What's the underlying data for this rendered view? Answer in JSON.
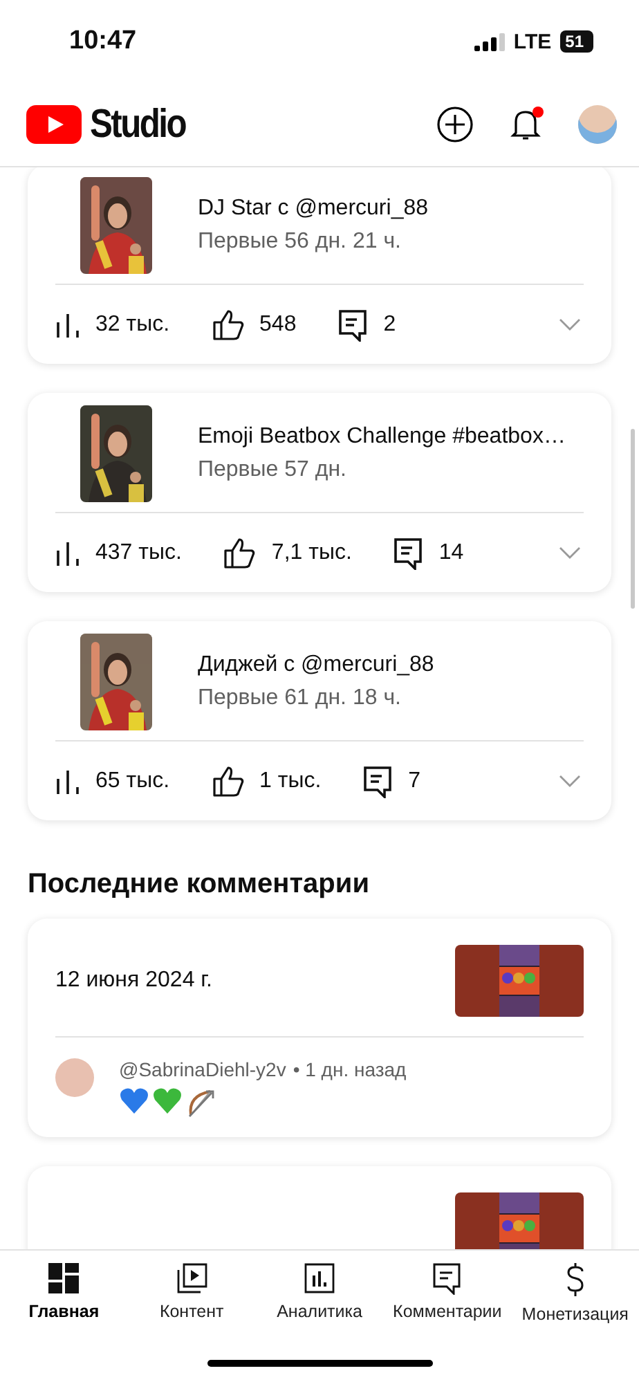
{
  "status_bar": {
    "time": "10:47",
    "network": "LTE",
    "battery": "51"
  },
  "header": {
    "logo_text": "Studio",
    "notification_badge": true
  },
  "recent_videos": {
    "videos": [
      {
        "title": "DJ Star с @mercuri_88",
        "subtitle": "Первые 56 дн. 21 ч.",
        "views": "32 тыс.",
        "likes": "548",
        "comments": "2"
      },
      {
        "title": "Emoji Beatbox Challenge #beatbox…",
        "subtitle": "Первые 57 дн.",
        "views": "437 тыс.",
        "likes": "7,1 тыс.",
        "comments": "14"
      },
      {
        "title": "Диджей с @mercuri_88",
        "subtitle": "Первые 61 дн. 18 ч.",
        "views": "65 тыс.",
        "likes": "1 тыс.",
        "comments": "7"
      }
    ]
  },
  "recent_comments": {
    "heading": "Последние комментарии",
    "cards": [
      {
        "date": "12 июня 2024 г.",
        "author": "@SabrinaDiehl-y2v",
        "time": "• 1 дн. назад"
      }
    ]
  },
  "bottom_nav": [
    {
      "label": "Главная",
      "kind": "home",
      "selected": true
    },
    {
      "label": "Контент",
      "kind": "content",
      "selected": false
    },
    {
      "label": "Аналитика",
      "kind": "analytics",
      "selected": false
    },
    {
      "label": "Комментарии",
      "kind": "comments",
      "selected": false
    },
    {
      "label": "Монетизация",
      "kind": "money",
      "selected": false
    }
  ]
}
